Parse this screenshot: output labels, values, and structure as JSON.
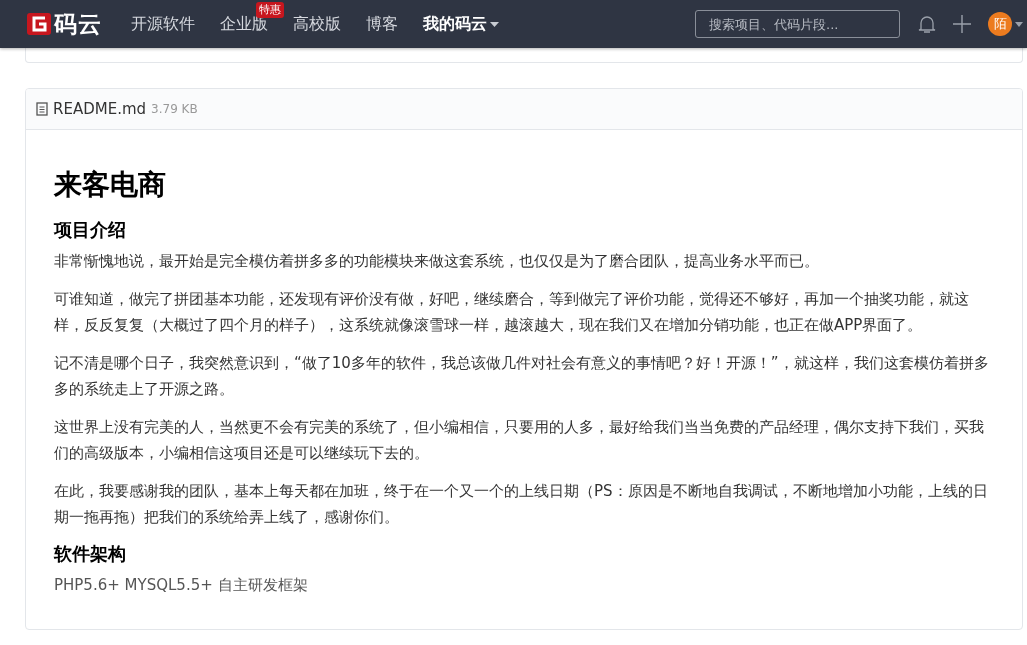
{
  "header": {
    "logo_text": "码云",
    "nav": [
      {
        "label": "开源软件",
        "selected": false
      },
      {
        "label": "企业版",
        "selected": false,
        "badge": "特惠"
      },
      {
        "label": "高校版",
        "selected": false
      },
      {
        "label": "博客",
        "selected": false
      },
      {
        "label": "我的码云",
        "selected": true,
        "dropdown": true
      }
    ],
    "search": {
      "placeholder": "搜索项目、代码片段..."
    },
    "avatar_text": "陌"
  },
  "readme": {
    "filename": "README.md",
    "size": "3.79 KB",
    "content": [
      {
        "kind": "h1",
        "text": "来客电商"
      },
      {
        "kind": "h2",
        "text": "项目介绍"
      },
      {
        "kind": "p",
        "text": "非常惭愧地说，最开始是完全模仿着拼多多的功能模块来做这套系统，也仅仅是为了磨合团队，提高业务水平而已。"
      },
      {
        "kind": "p",
        "text": "可谁知道，做完了拼团基本功能，还发现有评价没有做，好吧，继续磨合，等到做完了评价功能，觉得还不够好，再加一个抽奖功能，就这样，反反复复（大概过了四个月的样子），这系统就像滚雪球一样，越滚越大，现在我们又在增加分销功能，也正在做APP界面了。"
      },
      {
        "kind": "p",
        "text": "记不清是哪个日子，我突然意识到，“做了10多年的软件，我总该做几件对社会有意义的事情吧？好！开源！”，就这样，我们这套模仿着拼多多的系统走上了开源之路。"
      },
      {
        "kind": "p",
        "text": "这世界上没有完美的人，当然更不会有完美的系统了，但小编相信，只要用的人多，最好给我们当当免费的产品经理，偶尔支持下我们，买我们的高级版本，小编相信这项目还是可以继续玩下去的。"
      },
      {
        "kind": "p",
        "text": "在此，我要感谢我的团队，基本上每天都在加班，终于在一个又一个的上线日期（PS：原因是不断地自我调试，不断地增加小功能，上线的日期一拖再拖）把我们的系统给弄上线了，感谢你们。"
      },
      {
        "kind": "h2",
        "text": "软件架构"
      },
      {
        "kind": "p",
        "text": "PHP5.6+ MYSQL5.5+ 自主研发框架"
      }
    ]
  }
}
